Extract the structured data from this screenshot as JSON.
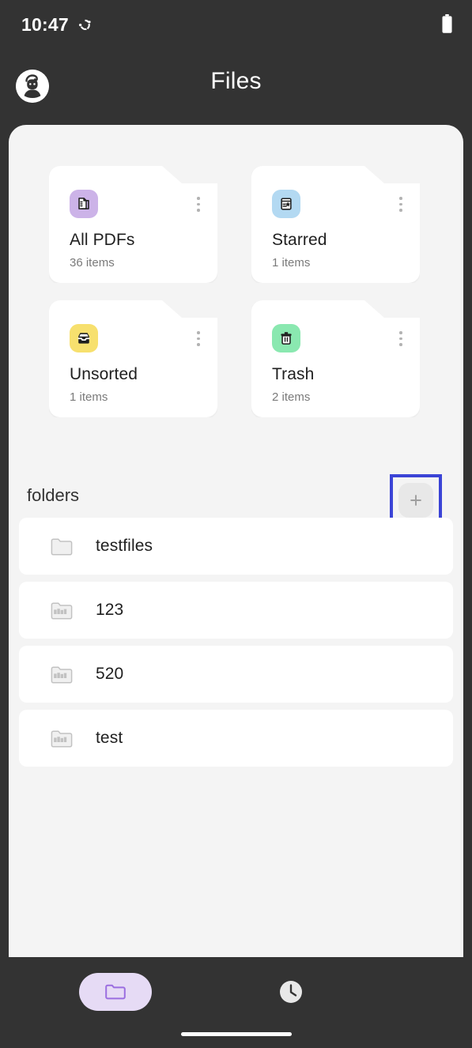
{
  "status_bar": {
    "time": "10:47",
    "sync_icon": "sync-icon",
    "battery_icon": "battery-full-icon"
  },
  "header": {
    "title": "Files",
    "avatar_icon": "user-avatar-icon"
  },
  "colors": {
    "screen_background": "#333333",
    "panel_background": "#f4f4f4",
    "card_background": "#ffffff",
    "highlight_border": "#3b44d6",
    "nav_active_pill": "#e6dbf5",
    "nav_active_icon": "#9b6ee0",
    "badge_all_pdfs": "#ccb3e8",
    "badge_starred": "#b3d9f2",
    "badge_unsorted": "#f7e06e",
    "badge_trash": "#8ae8b0"
  },
  "categories": [
    {
      "name": "All PDFs",
      "count": "36 items",
      "icon": "documents-icon",
      "badge_color": "#ccb3e8",
      "menu_icon": "kebab-menu-icon"
    },
    {
      "name": "Starred",
      "count": "1 items",
      "icon": "document-star-icon",
      "badge_color": "#b3d9f2",
      "menu_icon": "kebab-menu-icon"
    },
    {
      "name": "Unsorted",
      "count": "1 items",
      "icon": "inbox-tray-icon",
      "badge_color": "#f7e06e",
      "menu_icon": "kebab-menu-icon"
    },
    {
      "name": "Trash",
      "count": "2 items",
      "icon": "trash-can-icon",
      "badge_color": "#8ae8b0",
      "menu_icon": "kebab-menu-icon"
    }
  ],
  "folders_section": {
    "label": "folders",
    "add_button_icon": "plus-icon",
    "items": [
      {
        "name": "testfiles",
        "icon": "folder-empty-icon"
      },
      {
        "name": "123",
        "icon": "folder-files-icon"
      },
      {
        "name": "520",
        "icon": "folder-files-icon"
      },
      {
        "name": "test",
        "icon": "folder-files-icon"
      }
    ]
  },
  "bottom_nav": {
    "items": [
      {
        "icon": "folder-icon",
        "active": true
      },
      {
        "icon": "clock-recent-icon",
        "active": false
      }
    ]
  }
}
